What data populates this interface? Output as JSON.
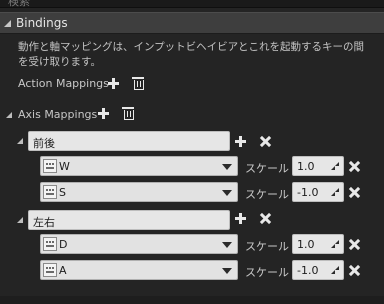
{
  "search": {
    "placeholder": "検索"
  },
  "category": {
    "title": "Bindings"
  },
  "description": {
    "line1": "動作と軸マッピングは、インプットビヘイビアとこれを起動するキーの間",
    "line2": "を受け取ります。"
  },
  "action_mappings": {
    "label": "Action Mappings"
  },
  "axis_mappings": {
    "label": "Axis Mappings",
    "groups": [
      {
        "name": "前後",
        "keys": [
          {
            "key": "W",
            "scale_label": "スケール",
            "scale": "1.0"
          },
          {
            "key": "S",
            "scale_label": "スケール",
            "scale": "-1.0"
          }
        ]
      },
      {
        "name": "左右",
        "keys": [
          {
            "key": "D",
            "scale_label": "スケール",
            "scale": "1.0"
          },
          {
            "key": "A",
            "scale_label": "スケール",
            "scale": "-1.0"
          }
        ]
      }
    ]
  },
  "icons": {
    "add": "plus-icon",
    "remove": "cross-icon",
    "delete": "trash-icon",
    "keyboard": "keyboard-icon",
    "dropdown": "chevron-down-icon",
    "expand": "triangle-expanded-icon"
  },
  "colors": {
    "background": "#242424",
    "header": "#3e3e3e",
    "input": "#e6e6e6",
    "text": "#c8c8c8"
  }
}
